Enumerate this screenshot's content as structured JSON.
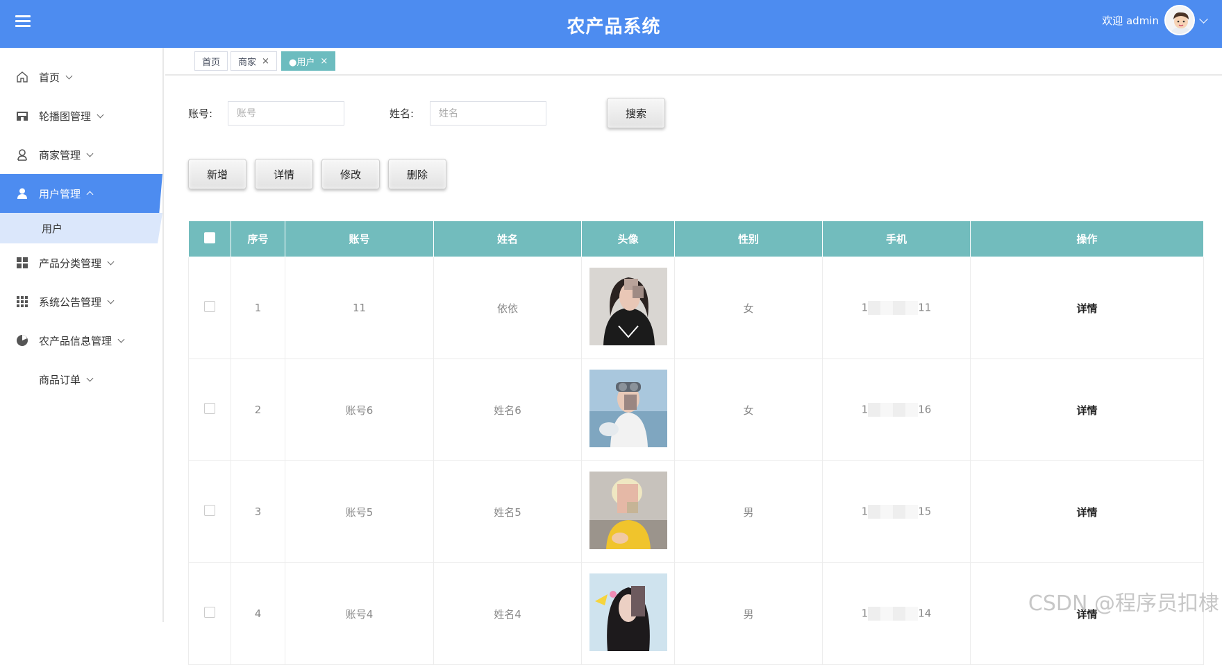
{
  "header": {
    "title": "农产品系统",
    "welcome": "欢迎 admin"
  },
  "sidebar": {
    "items": [
      {
        "label": "首页",
        "icon": "home-icon"
      },
      {
        "label": "轮播图管理",
        "icon": "store-icon"
      },
      {
        "label": "商家管理",
        "icon": "merchant-icon"
      },
      {
        "label": "用户管理",
        "icon": "user-icon",
        "active": true
      },
      {
        "label": "产品分类管理",
        "icon": "grid-icon"
      },
      {
        "label": "系统公告管理",
        "icon": "apps-icon"
      },
      {
        "label": "农产品信息管理",
        "icon": "pie-icon"
      },
      {
        "label": "商品订单",
        "icon": ""
      }
    ],
    "sub_item": "用户"
  },
  "tabs": [
    {
      "label": "首页"
    },
    {
      "label": "商家",
      "close": "×"
    },
    {
      "label": "●用户",
      "close": "×",
      "active": true
    }
  ],
  "search": {
    "account_label": "账号:",
    "account_placeholder": "账号",
    "name_label": "姓名:",
    "name_placeholder": "姓名",
    "search_button": "搜索"
  },
  "actions": {
    "add": "新增",
    "detail": "详情",
    "edit": "修改",
    "delete": "删除"
  },
  "table": {
    "columns": [
      "序号",
      "账号",
      "姓名",
      "头像",
      "性别",
      "手机",
      "操作"
    ],
    "rows": [
      {
        "index": "1",
        "account": "11",
        "name": "依依",
        "gender": "女",
        "phone_start": "1",
        "phone_end": "11",
        "op": "详情"
      },
      {
        "index": "2",
        "account": "账号6",
        "name": "姓名6",
        "gender": "女",
        "phone_start": "1",
        "phone_end": "16",
        "op": "详情"
      },
      {
        "index": "3",
        "account": "账号5",
        "name": "姓名5",
        "gender": "男",
        "phone_start": "1",
        "phone_end": "15",
        "op": "详情"
      },
      {
        "index": "4",
        "account": "账号4",
        "name": "姓名4",
        "gender": "男",
        "phone_start": "1",
        "phone_end": "14",
        "op": "详情"
      }
    ]
  },
  "watermark": "CSDN @程序员扣棣",
  "colors": {
    "header": "#4d8cf0",
    "table_header": "#72bcbd",
    "active_tab": "#6cbcbf"
  }
}
